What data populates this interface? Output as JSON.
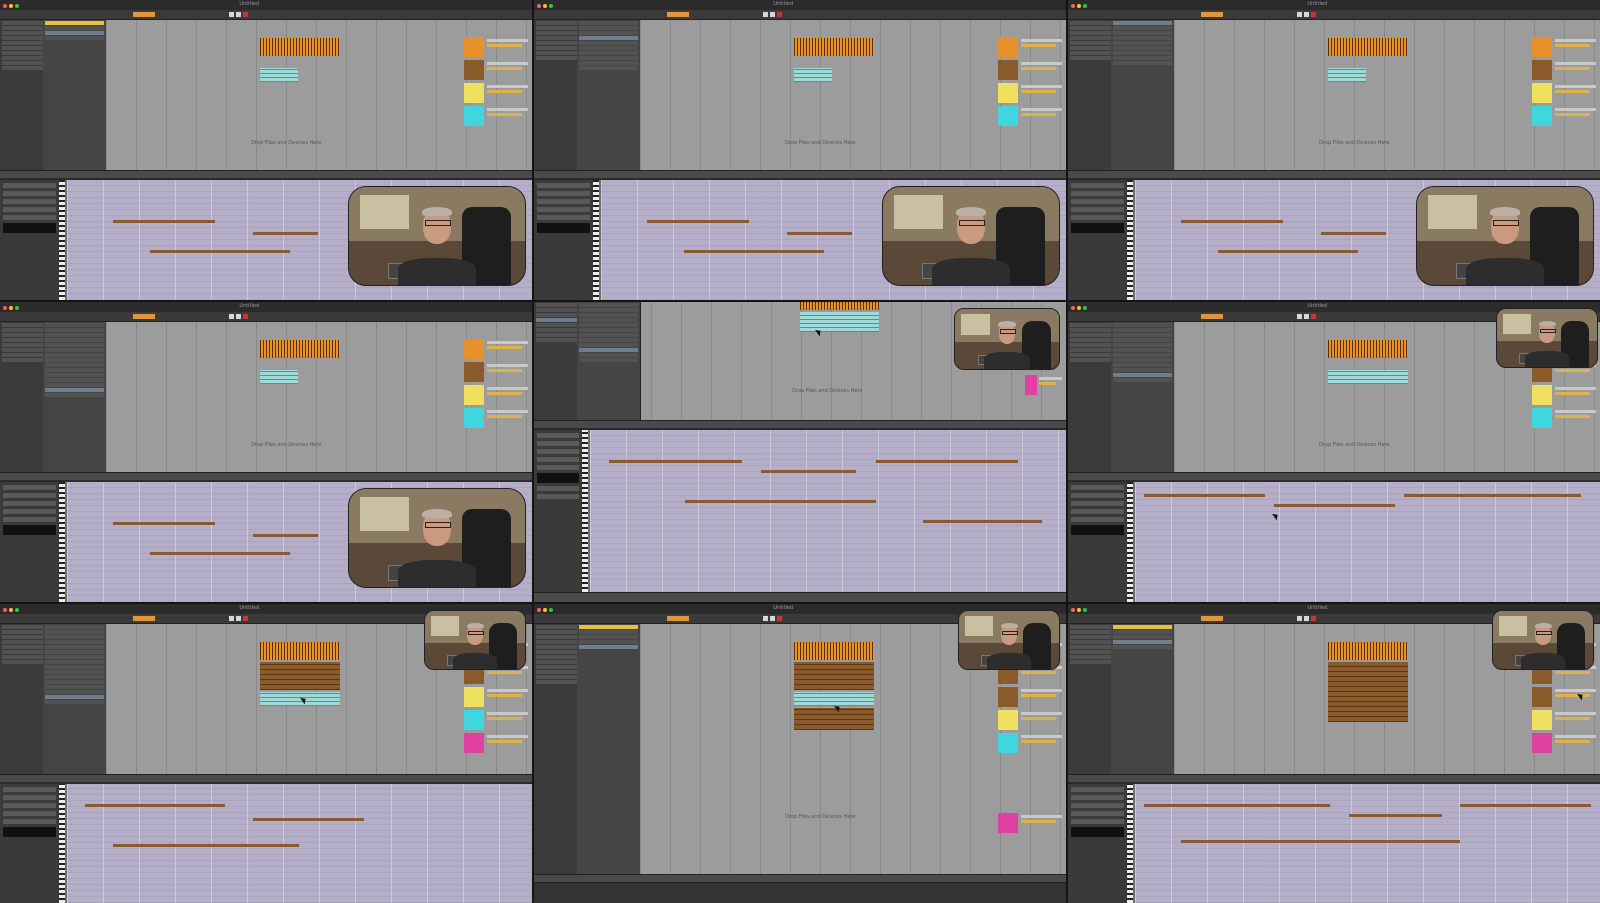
{
  "layout": "contact sheet of 9 frames (3x3) from a screen-recorded music production session",
  "app_window": {
    "title": "Untitled"
  },
  "hints": {
    "session_drop": "Drop Files and Devices Here"
  },
  "colors": {
    "audio_clip": "#e8942a",
    "midi_clip": "#9fd9d8",
    "track_orange": "#e8902a",
    "track_brown": "#8b5a2b",
    "track_yellow": "#f0e060",
    "track_cyan": "#3fd6e0",
    "track_pink": "#e040a0",
    "piano_roll": "#b4aec9"
  },
  "frames": [
    {
      "id": 1,
      "cam": true
    },
    {
      "id": 2,
      "cam": true
    },
    {
      "id": 3,
      "cam": true
    },
    {
      "id": 4,
      "cam": true
    },
    {
      "id": 5,
      "cam": true
    },
    {
      "id": 6,
      "cam": true
    },
    {
      "id": 7,
      "cam": true
    },
    {
      "id": 8,
      "cam": true
    },
    {
      "id": 9,
      "cam": true
    }
  ]
}
